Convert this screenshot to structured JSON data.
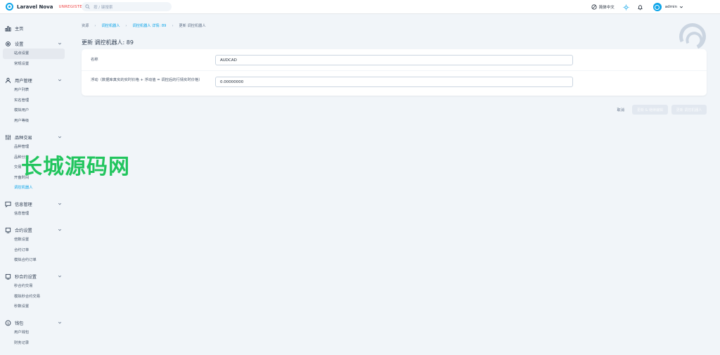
{
  "brand": {
    "name": "Laravel Nova",
    "badge": "UNREGISTERED"
  },
  "search": {
    "placeholder": "按 / 键搜索"
  },
  "header": {
    "language": "简体中文",
    "user": "admin"
  },
  "sidebar": {
    "home": "主页",
    "groups": [
      {
        "label": "设置",
        "items": [
          "站点设置",
          "常规设置"
        ]
      },
      {
        "label": "用户管理",
        "items": [
          "用户列表",
          "实名管理",
          "模拟用户",
          "用户等级"
        ]
      },
      {
        "label": "品种交易",
        "items": [
          "品种管理",
          "品种分类",
          "交易",
          "开盘时间",
          "调控机器人"
        ]
      },
      {
        "label": "信息管理",
        "items": [
          "信息管理"
        ]
      },
      {
        "label": "合约设置",
        "items": [
          "倍数设置",
          "合约订单",
          "模拟合约订单"
        ]
      },
      {
        "label": "秒合约设置",
        "items": [
          "秒合约交易",
          "模拟秒合约交易",
          "秒数设置"
        ]
      },
      {
        "label": "钱包",
        "items": [
          "用户钱包",
          "财务记录"
        ]
      }
    ]
  },
  "breadcrumb": [
    "资源",
    "调控机器人",
    "调控机器人 详情: 89",
    "更新 调控机器人"
  ],
  "page": {
    "title": "更新 调控机器人: 89"
  },
  "form": {
    "fields": [
      {
        "label": "名称",
        "value": "AUDCAD"
      },
      {
        "label": "浮动（数据库真实的实时价格 + 浮动值 = 调控后的行情实时价格）",
        "value": "0.00000000"
      }
    ]
  },
  "actions": {
    "cancel": "取消",
    "update_continue": "更新 & 继续编辑",
    "update": "更新 调控机器人"
  },
  "watermark": "长城源码网",
  "colors": {
    "accent": "#0ea5e9",
    "badge": "#ef4444",
    "watermark": "#22c55e"
  }
}
